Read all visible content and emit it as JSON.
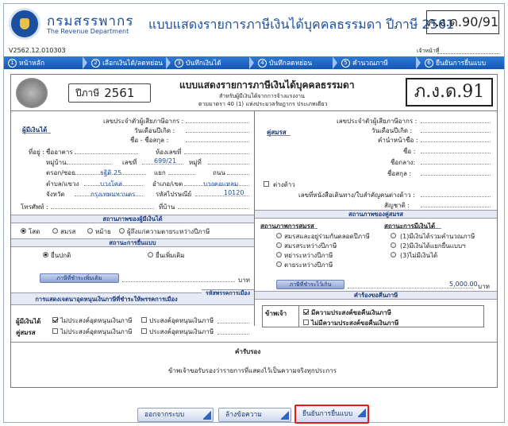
{
  "header": {
    "org_th": "กรมสรรพากร",
    "org_en": "The Revenue Department",
    "title": "แบบแสดงรายการภาษีเงินได้บุคคลธรรมดา ปีภาษี 2561",
    "form_code": "ภ.ง.ด.90/91",
    "version": "V2562.12.010303",
    "user_label": "เจ้าหน้าที่"
  },
  "steps": [
    {
      "n": "1",
      "label": "หน้าหลัก"
    },
    {
      "n": "2",
      "label": "เลือกเงินได้/ลดหย่อน"
    },
    {
      "n": "3",
      "label": "บันทึกเงินได้"
    },
    {
      "n": "4",
      "label": "บันทึกลดหย่อน"
    },
    {
      "n": "5",
      "label": "คำนวณภาษี"
    },
    {
      "n": "6",
      "label": "ยืนยันการยื่นแบบ"
    }
  ],
  "form": {
    "year_label": "ปีภาษี",
    "year": "2561",
    "title": "แบบแสดงรายการภาษีเงินได้บุคคลธรรมดา",
    "sub1": "สำหรับผู้มีเงินได้จากการจ้างแรงงาน",
    "sub2": "ตามมาตรา 40 (1) แห่งประมวลรัษฎากร ประเภทเดียว",
    "code": "ภ.ง.ด.91"
  },
  "left": {
    "taxid_label": "เลขประจำตัวผู้เสียภาษีอากร :",
    "taxpayer_label": "ผู้มีเงินได้",
    "dob_label": "วันเดือนปีเกิด :",
    "name_label": "ชื่อ - ชื่อสกุล :",
    "addr_label": "ที่อยู่ :",
    "building_label": "ชื่ออาคาร",
    "room_label": "ห้องเลขที่",
    "village_label": "หมู่บ้าน",
    "no_label": "เลขที่",
    "no_value": "699/21",
    "moo_label": "หมู่ที่",
    "soi_label": "ตรอก/ซอย",
    "soi_value": "ธฐิติ 25",
    "yaek_label": "แยก",
    "road_label": "ถนน",
    "subdistrict_label": "ตำบล/แขวง",
    "subdistrict_value": "บางโคล่",
    "district_label": "อำเภอ/เขต",
    "district_value": "บางคอแหลม",
    "province_label": "จังหวัด",
    "province_value": "กรุงเทพมหานคร",
    "postcode_label": "รหัสไปรษณีย์",
    "postcode_value": "10120",
    "phone_label": "โทรศัพท์ :",
    "home_label": "ที่บ้าน",
    "status_header": "สถานภาพของผู้มีเงินได้",
    "status_options": [
      "โสด",
      "สมรส",
      "หม้าย",
      "ผู้ถึงแก่ความตายระหว่างปีภาษี"
    ],
    "filing_header": "สถานะการยื่นแบบ",
    "filing_options": [
      "ยื่นปกติ",
      "ยื่นเพิ่มเติม"
    ],
    "extra_tax_label": "ภาษีที่ชำระเพิ่มเติม",
    "baht": "บาท",
    "party_header": "การแสดงเจตนาอุดหนุนเงินภาษีที่ชำระให้พรรคการเมือง",
    "party_code_header": "รหัสพรรคการเมือง",
    "taxpayer_row": "ผู้มีเงินได้",
    "spouse_row": "คู่สมรส",
    "no_support": "ไม่ประสงค์อุดหนุนเงินภาษี",
    "support": "ประสงค์อุดหนุนเงินภาษี"
  },
  "right": {
    "spouse_label": "คู่สมรส",
    "taxid_label": "เลขประจำตัวผู้เสียภาษีอากร :",
    "dob_label": "วันเดือนปีเกิด :",
    "prefix_label": "คำนำหน้าชื่อ :",
    "name_label": "ชื่อ :",
    "middle_label": "ชื่อกลาง:",
    "surname_label": "ชื่อสกุล :",
    "foreign_label": "ต่างด้าว",
    "passport_label": "เลขที่หนังสือเดินทาง/ใบสำคัญคนต่างด้าว :",
    "nationality_label": "สัญชาติ :",
    "status_header": "สถานภาพของคู่สมรส",
    "marriage_label": "สถานภาพการสมรส",
    "marriage_options": [
      "สมรสและอยู่ร่วมกันตลอดปีภาษี",
      "สมรสระหว่างปีภาษี",
      "หย่าระหว่างปีภาษี",
      "ตายระหว่างปีภาษี"
    ],
    "income_label": "สถานะการมีเงินได้",
    "income_options": [
      "(1)มีเงินได้รวมคำนวณภาษี",
      "(2)มีเงินได้แยกยื่นแบบฯ",
      "(3)ไม่มีเงินได้"
    ],
    "refund_label": "ภาษีที่ชำระไว้เกิน",
    "refund_value": "5,000.00",
    "baht": "บาท",
    "refund_header": "คำร้องขอคืนภาษี",
    "owner_label": "ข้าพเจ้า",
    "want_refund": "มีความประสงค์ขอคืนเงินภาษี",
    "no_refund": "ไม่มีความประสงค์ขอคืนเงินภาษี"
  },
  "certify": {
    "header": "คำรับรอง",
    "text": "ข้าพเจ้าขอรับรองว่ารายการที่แสดงไว้เป็นความจริงทุกประการ"
  },
  "buttons": {
    "exit": "ออกจากระบบ",
    "clear": "ล้างข้อความ",
    "confirm": "ยืนยันการยื่นแบบ"
  }
}
